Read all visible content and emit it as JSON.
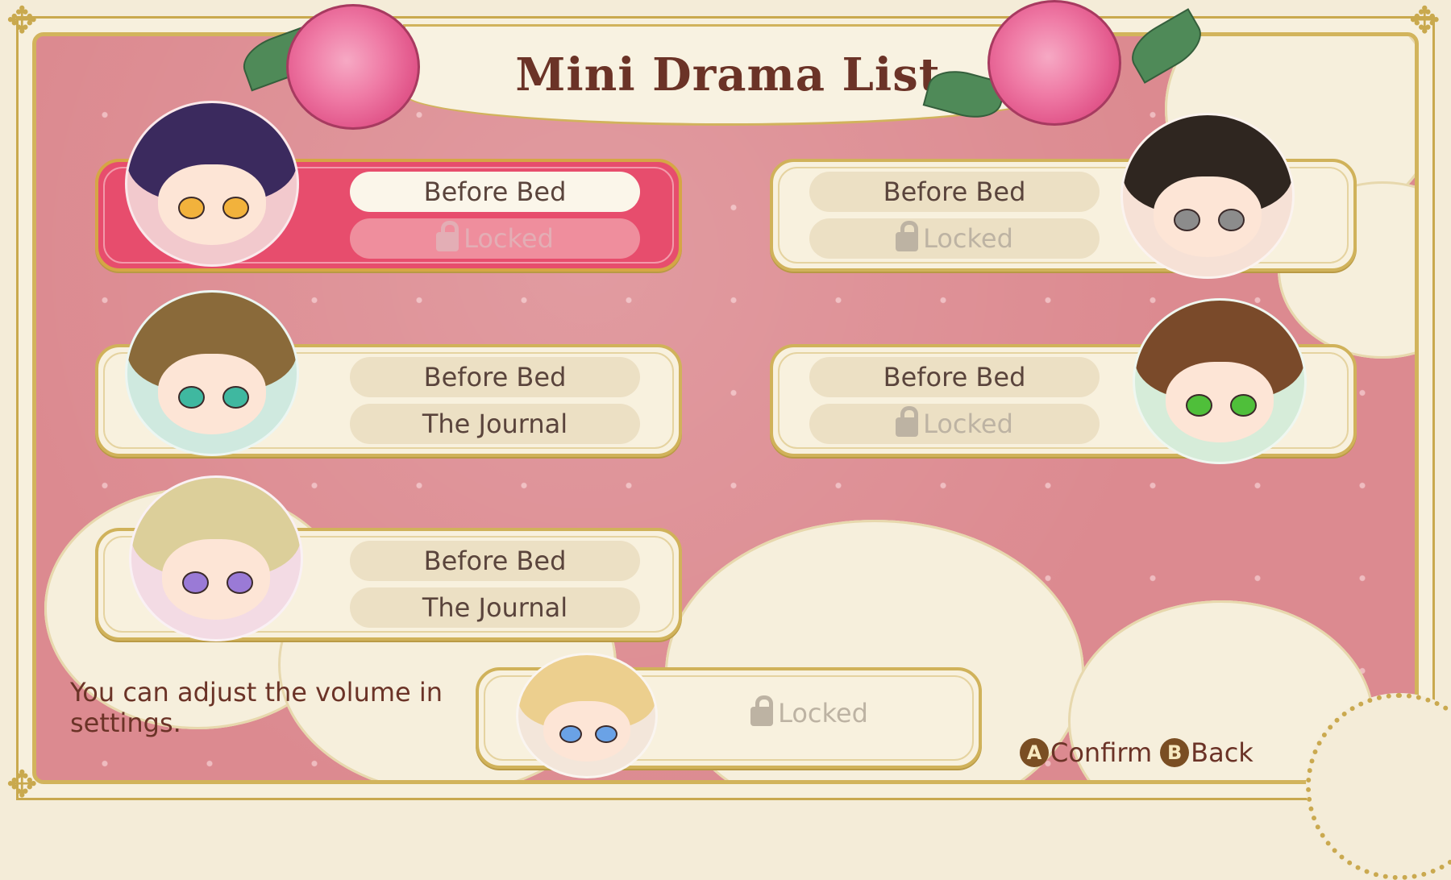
{
  "title": "Mini Drama List",
  "cards": [
    {
      "id": "c1",
      "top": "Before Bed",
      "bottom": "Locked",
      "bottom_locked": true,
      "selected": true
    },
    {
      "id": "c2",
      "top": "Before Bed",
      "bottom": "Locked",
      "bottom_locked": true,
      "selected": false
    },
    {
      "id": "c3",
      "top": "Before Bed",
      "bottom": "The Journal",
      "bottom_locked": false,
      "selected": false
    },
    {
      "id": "c4",
      "top": "Before Bed",
      "bottom": "Locked",
      "bottom_locked": true,
      "selected": false
    },
    {
      "id": "c5",
      "top": "Before Bed",
      "bottom": "The Journal",
      "bottom_locked": false,
      "selected": false
    },
    {
      "id": "c6",
      "single": "Locked",
      "bottom_locked": true,
      "selected": false
    }
  ],
  "hint": "You can adjust the volume in settings.",
  "controls": {
    "confirm_glyph": "A",
    "confirm_label": "Confirm",
    "back_glyph": "B",
    "back_label": "Back"
  },
  "colors": {
    "panel_bg": "#dc8a90",
    "selected_card": "#e74d6d",
    "gold": "#d0b25a",
    "text_dark": "#6b3327"
  },
  "icons": [
    "rose-icon",
    "lock-icon",
    "corner-ornament-icon",
    "gear-ornament-icon"
  ]
}
